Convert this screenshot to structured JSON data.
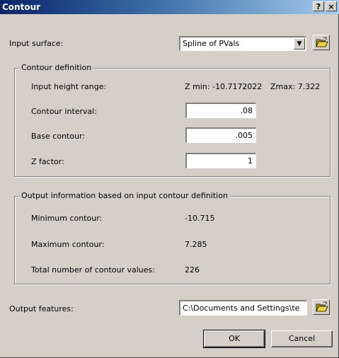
{
  "window": {
    "title": "Contour",
    "help_label": "?",
    "close_label": "×"
  },
  "input_surface": {
    "label": "Input surface:",
    "value": "Spline of PVals"
  },
  "contour_definition": {
    "title": "Contour definition",
    "height_range_label": "Input height range:",
    "zmin_text": "Z min: -10.7172022",
    "zmax_text": "Zmax: 7.322",
    "interval_label": "Contour interval:",
    "interval_value": ".08",
    "base_label": "Base contour:",
    "base_value": ".005",
    "zfactor_label": "Z factor:",
    "zfactor_value": "1"
  },
  "output_info": {
    "title": "Output information based on input contour definition",
    "min_label": "Minimum contour:",
    "min_value": "-10.715",
    "max_label": "Maximum contour:",
    "max_value": "7.285",
    "total_label": "Total number of contour values:",
    "total_value": "226"
  },
  "output_features": {
    "label": "Output features:",
    "value": "C:\\Documents and Settings\\te"
  },
  "buttons": {
    "ok_label": "OK",
    "cancel_label": "Cancel"
  },
  "icons": {
    "folder": "open-folder-icon",
    "dropdown": "chevron-down-icon"
  },
  "colors": {
    "title_start": "#0a246a",
    "title_end": "#a6caf0",
    "dialog_face": "#d4d0c8"
  }
}
